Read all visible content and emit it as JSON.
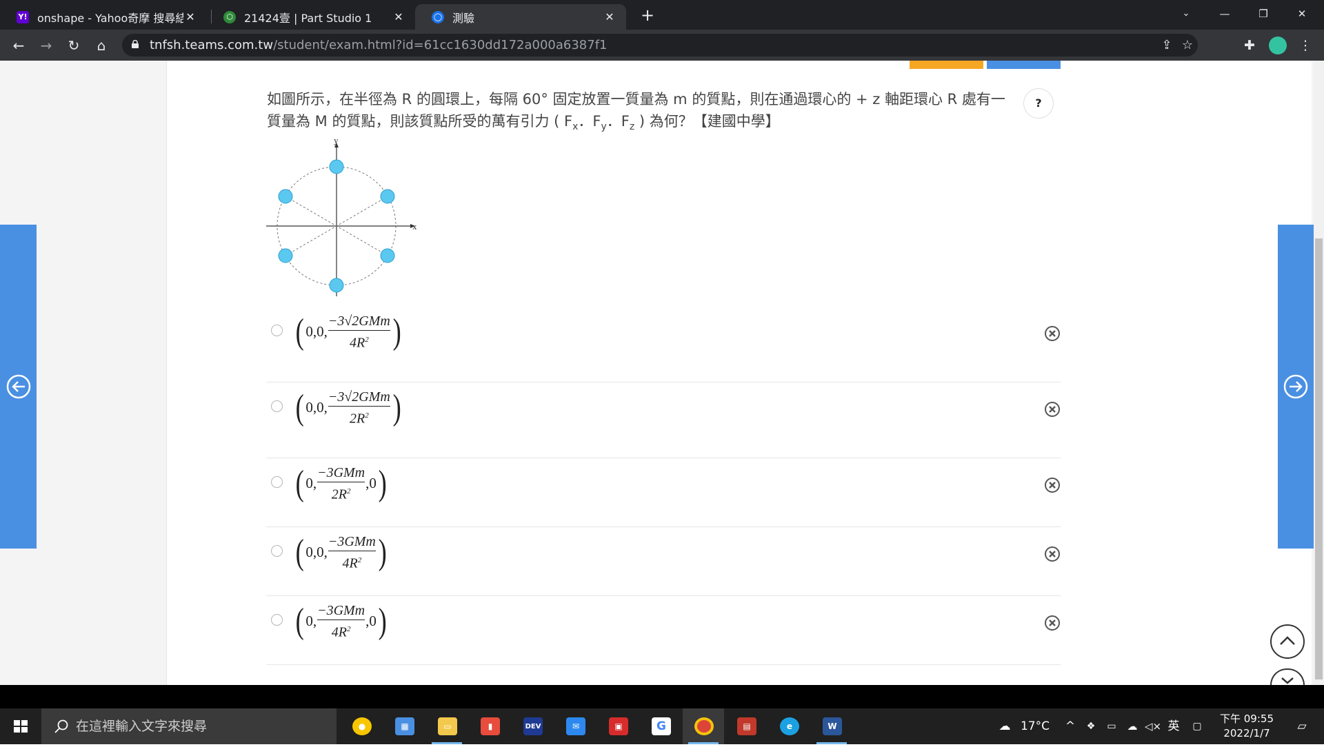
{
  "browser": {
    "tabs": [
      {
        "title": "onshape - Yahoo奇摩 搜尋結果",
        "favicon": "yahoo-icon",
        "favicon_color": "#6001d2"
      },
      {
        "title": "21424壹 | Part Studio 1",
        "favicon": "onshape-icon",
        "favicon_color": "#2f8a3a"
      },
      {
        "title": "測驗",
        "favicon": "teams-icon",
        "favicon_color": "#1a73e8"
      }
    ],
    "url_host": "tnfsh.teams.com.tw",
    "url_path": "/student/exam.html?id=61cc1630dd172a000a6387f1"
  },
  "exam": {
    "question": "如圖所示，在半徑為 R 的圓環上，每隔 60° 固定放置一質量為 m 的質點，則在通過環心的 + z 軸距環心 R 處有一質量為 M 的質點，則該質點所受的萬有引力 ( F",
    "q_sub_x": "x",
    "q_sep1": "．F",
    "q_sub_y": "y",
    "q_sep2": "．F",
    "q_sub_z": "z",
    "q_end": " ) 為何？【建國中學】",
    "help_label": "?",
    "diagram": {
      "axis_x": "x",
      "axis_y": "y",
      "mass_color": "#5bc8f0"
    },
    "options": [
      {
        "prefix": "0,0,",
        "num": "−3√2GMm",
        "den": "4R",
        "suffix": ""
      },
      {
        "prefix": "0,0,",
        "num": "−3√2GMm",
        "den": "2R",
        "suffix": ""
      },
      {
        "prefix": "0,",
        "num": "−3GMm",
        "den": "2R",
        "suffix": ",0"
      },
      {
        "prefix": "0,0,",
        "num": "−3GMm",
        "den": "4R",
        "suffix": ""
      },
      {
        "prefix": "0,",
        "num": "−3GMm",
        "den": "4R",
        "suffix": ",0"
      }
    ],
    "den_exponent": "2"
  },
  "taskbar": {
    "search_placeholder": "在這裡輸入文字來搜尋",
    "weather": "17°C",
    "ime_lang": "英",
    "time": "下午 09:55",
    "date": "2022/1/7"
  }
}
